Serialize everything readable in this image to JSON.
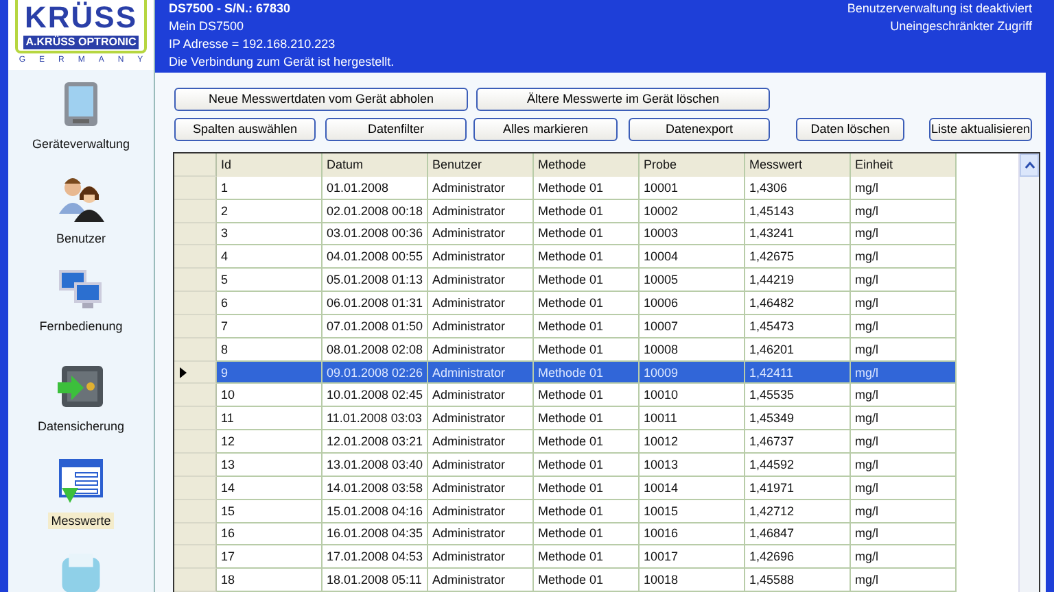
{
  "logo": {
    "brand": "KRÜSS",
    "company": "A.KRÜSS OPTRONIC",
    "country": "GERMANY"
  },
  "header": {
    "device": "DS7500 - S/N.: 67830",
    "name": "Mein DS7500",
    "ip": "IP Adresse = 192.168.210.223",
    "connection": "Die Verbindung zum Gerät ist hergestellt.",
    "user_admin": "Benutzerverwaltung ist deaktiviert",
    "access": "Uneingeschränkter Zugriff"
  },
  "sidebar": {
    "items": [
      {
        "label": "Geräteverwaltung",
        "selected": false
      },
      {
        "label": "Benutzer",
        "selected": false
      },
      {
        "label": "Fernbedienung",
        "selected": false
      },
      {
        "label": "Datensicherung",
        "selected": false
      },
      {
        "label": "Messwerte",
        "selected": true
      }
    ]
  },
  "buttons_row_1": [
    "Neue Messwertdaten vom Gerät abholen",
    "Ältere Messwerte im Gerät löschen"
  ],
  "buttons_row_2": [
    "Spalten auswählen",
    "Datenfilter",
    "Alles markieren",
    "Datenexport",
    "Daten löschen",
    "Liste aktualisieren"
  ],
  "table": {
    "columns": [
      "Id",
      "Datum",
      "Benutzer",
      "Methode",
      "Probe",
      "Messwert",
      "Einheit"
    ],
    "rows": [
      {
        "cells": [
          "1",
          "01.01.2008",
          "Administrator",
          "Methode 01",
          "10001",
          "1,4306",
          "mg/l"
        ],
        "selected": false
      },
      {
        "cells": [
          "2",
          "02.01.2008 00:18",
          "Administrator",
          "Methode 01",
          "10002",
          "1,45143",
          "mg/l"
        ],
        "selected": false
      },
      {
        "cells": [
          "3",
          "03.01.2008 00:36",
          "Administrator",
          "Methode 01",
          "10003",
          "1,43241",
          "mg/l"
        ],
        "selected": false
      },
      {
        "cells": [
          "4",
          "04.01.2008 00:55",
          "Administrator",
          "Methode 01",
          "10004",
          "1,42675",
          "mg/l"
        ],
        "selected": false
      },
      {
        "cells": [
          "5",
          "05.01.2008 01:13",
          "Administrator",
          "Methode 01",
          "10005",
          "1,44219",
          "mg/l"
        ],
        "selected": false
      },
      {
        "cells": [
          "6",
          "06.01.2008 01:31",
          "Administrator",
          "Methode 01",
          "10006",
          "1,46482",
          "mg/l"
        ],
        "selected": false
      },
      {
        "cells": [
          "7",
          "07.01.2008 01:50",
          "Administrator",
          "Methode 01",
          "10007",
          "1,45473",
          "mg/l"
        ],
        "selected": false
      },
      {
        "cells": [
          "8",
          "08.01.2008 02:08",
          "Administrator",
          "Methode 01",
          "10008",
          "1,46201",
          "mg/l"
        ],
        "selected": false
      },
      {
        "cells": [
          "9",
          "09.01.2008 02:26",
          "Administrator",
          "Methode 01",
          "10009",
          "1,42411",
          "mg/l"
        ],
        "selected": true
      },
      {
        "cells": [
          "10",
          "10.01.2008 02:45",
          "Administrator",
          "Methode 01",
          "10010",
          "1,45535",
          "mg/l"
        ],
        "selected": false
      },
      {
        "cells": [
          "11",
          "11.01.2008 03:03",
          "Administrator",
          "Methode 01",
          "10011",
          "1,45349",
          "mg/l"
        ],
        "selected": false
      },
      {
        "cells": [
          "12",
          "12.01.2008 03:21",
          "Administrator",
          "Methode 01",
          "10012",
          "1,46737",
          "mg/l"
        ],
        "selected": false
      },
      {
        "cells": [
          "13",
          "13.01.2008 03:40",
          "Administrator",
          "Methode 01",
          "10013",
          "1,44592",
          "mg/l"
        ],
        "selected": false
      },
      {
        "cells": [
          "14",
          "14.01.2008 03:58",
          "Administrator",
          "Methode 01",
          "10014",
          "1,41971",
          "mg/l"
        ],
        "selected": false
      },
      {
        "cells": [
          "15",
          "15.01.2008 04:16",
          "Administrator",
          "Methode 01",
          "10015",
          "1,42712",
          "mg/l"
        ],
        "selected": false
      },
      {
        "cells": [
          "16",
          "16.01.2008 04:35",
          "Administrator",
          "Methode 01",
          "10016",
          "1,46847",
          "mg/l"
        ],
        "selected": false
      },
      {
        "cells": [
          "17",
          "17.01.2008 04:53",
          "Administrator",
          "Methode 01",
          "10017",
          "1,42696",
          "mg/l"
        ],
        "selected": false
      },
      {
        "cells": [
          "18",
          "18.01.2008 05:11",
          "Administrator",
          "Methode 01",
          "10018",
          "1,45588",
          "mg/l"
        ],
        "selected": false
      }
    ]
  }
}
